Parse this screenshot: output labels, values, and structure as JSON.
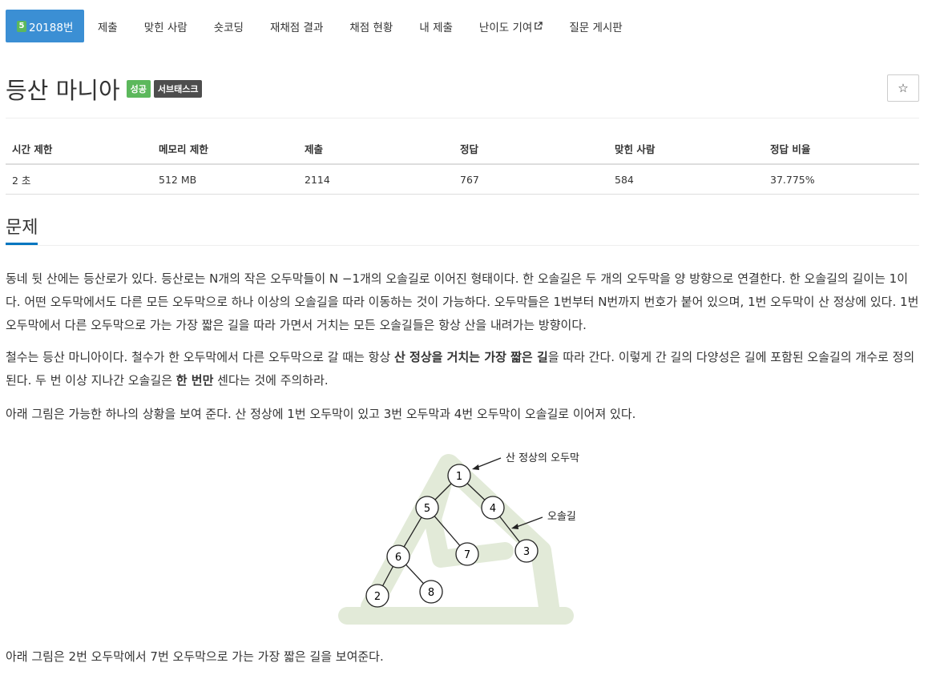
{
  "nav": {
    "active": {
      "badge": "5",
      "label": "20188번"
    },
    "items": [
      "제출",
      "맞힌 사람",
      "숏코딩",
      "재채점 결과",
      "채점 현황",
      "내 제출",
      "난이도 기여",
      "질문 게시판"
    ]
  },
  "problem": {
    "title": "등산 마니아",
    "status_label": "성공",
    "tag_label": "서브태스크",
    "star": "☆"
  },
  "info": {
    "headers": [
      "시간 제한",
      "메모리 제한",
      "제출",
      "정답",
      "맞힌 사람",
      "정답 비율"
    ],
    "values": [
      "2 초",
      "512 MB",
      "2114",
      "767",
      "584",
      "37.775%"
    ]
  },
  "section": {
    "title": "문제"
  },
  "paragraphs": {
    "p1": "동네 뒷 산에는 등산로가 있다. 등산로는 N개의 작은 오두막들이 N −1개의 오솔길로 이어진 형태이다. 한 오솔길은 두 개의 오두막을 양 방향으로 연결한다. 한 오솔길의 길이는 1이다. 어떤 오두막에서도 다른 모든 오두막으로 하나 이상의 오솔길을 따라 이동하는 것이 가능하다. 오두막들은 1번부터 N번까지 번호가 붙어 있으며, 1번 오두막이 산 정상에 있다. 1번 오두막에서 다른 오두막으로 가는 가장 짧은 길을 따라 가면서 거치는 모든 오솔길들은 항상 산을 내려가는 방향이다.",
    "p2_a": "철수는 등산 마니아이다. 철수가 한 오두막에서 다른 오두막으로 갈 때는 항상 ",
    "p2_b": "산 정상을 거치는 가장 짧은 길",
    "p2_c": "을 따라 간다. 이렇게 간 길의 다양성은 길에 포함된 오솔길의 개수로 정의된다. 두 번 이상 지나간 오솔길은 ",
    "p2_d": "한 번만",
    "p2_e": " 센다는 것에 주의하라.",
    "p3": "아래 그림은 가능한 하나의 상황을 보여 준다. 산 정상에 1번 오두막이 있고 3번 오두막과 4번 오두막이 오솔길로 이어져 있다.",
    "p4": "아래 그림은 2번 오두막에서 7번 오두막으로 가는 가장 짧은 길을 보여준다."
  },
  "figure": {
    "summit_label": "산 정상의 오두막",
    "trail_label": "오솔길",
    "nodes": [
      "1",
      "5",
      "4",
      "6",
      "7",
      "3",
      "2",
      "8"
    ]
  }
}
